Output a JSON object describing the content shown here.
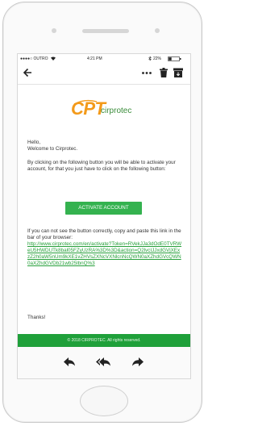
{
  "status": {
    "carrier": "●●●●○ OUTRO",
    "time": "4:21 PM",
    "battery": "22%"
  },
  "toolbar": {
    "back_icon": "back-arrow-icon",
    "more_icon": "more-icon",
    "trash_icon": "trash-icon",
    "archive_icon": "archive-icon"
  },
  "logo": {
    "mark": "CPT",
    "name": "cirprotec",
    "color_primary": "#f39a1a",
    "color_secondary": "#3a8c3a"
  },
  "email": {
    "greeting": "Hello,",
    "welcome": "Welcome to Cirprotec.",
    "instruction": "By clicking on the following button you will be able to activate your account, for that you just have to click on the following button:",
    "button_label": "ACTIVATE ACCOUNT",
    "fallback": "If you can not see the button correctly, copy and paste this link in the bar of your browser:",
    "link": "http://www.cirprotec.com/en/activate?Token=RVekJJa3dOdE0TVRWeU5HWDUTk8bal05FZyUzRA%3D%3D&action=Q2lvcIJJxdGVjXExzZ2h0aW5nUm9kXE1vZHVsZXNcVXNlcnNcQWN0aXZhdGVcQWN0aXZhdGVDb21wb25lbnQ%3",
    "thanks": "Thanks!"
  },
  "footer": {
    "copyright": "© 2018 CIRPROTEC. All rights reserved."
  },
  "actions": {
    "reply": "reply-icon",
    "reply_all": "reply-all-icon",
    "forward": "forward-icon"
  },
  "colors": {
    "accent": "#34b24f",
    "footer": "#1fa03a"
  }
}
